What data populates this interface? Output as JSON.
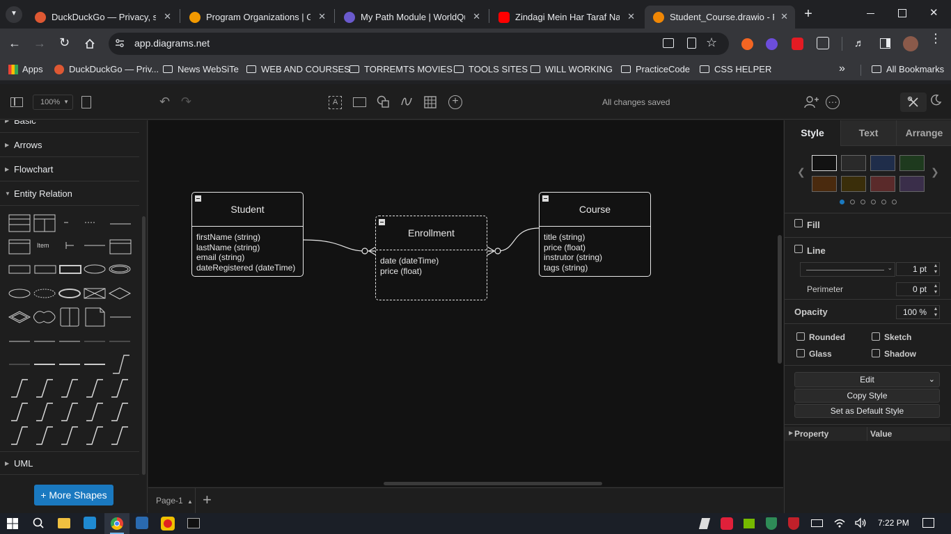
{
  "browser": {
    "tabs": [
      {
        "title": "DuckDuckGo — Privacy, simp",
        "color": "#de5833"
      },
      {
        "title": "Program Organizations | Go",
        "color": "#f29900"
      },
      {
        "title": "My Path Module | WorldQua",
        "color": "#6a5acd"
      },
      {
        "title": "Zindagi Mein Har Taraf Na-K",
        "color": "#ff0000"
      },
      {
        "title": "Student_Course.drawio - Pag",
        "color": "#f08705"
      }
    ],
    "url": "app.diagrams.net",
    "bookmarks": [
      {
        "label": "Apps",
        "icon": "apps-grid-icon"
      },
      {
        "label": "DuckDuckGo — Priv...",
        "icon": "duckduckgo-icon"
      },
      {
        "label": "News WebSiTe",
        "icon": "folder-icon"
      },
      {
        "label": "WEB AND COURSES",
        "icon": "folder-icon"
      },
      {
        "label": "TORREMTS  MOVIES",
        "icon": "folder-icon"
      },
      {
        "label": "TOOLS SITES",
        "icon": "folder-icon"
      },
      {
        "label": "WILL WORKING",
        "icon": "folder-icon"
      },
      {
        "label": "PracticeCode",
        "icon": "folder-icon"
      },
      {
        "label": "CSS HELPER",
        "icon": "folder-icon"
      }
    ],
    "all_bookmarks": "All Bookmarks",
    "more_bookmarks": "»"
  },
  "app": {
    "zoom": "100%",
    "save_status": "All changes saved",
    "sidebar": {
      "sections": [
        "Basic",
        "Arrows",
        "Flowchart",
        "Entity Relation",
        "UML"
      ],
      "shape_item_label": "Item",
      "more_shapes": "+ More Shapes"
    },
    "page": {
      "name": "Page-1"
    },
    "format": {
      "tabs": [
        "Style",
        "Text",
        "Arrange"
      ],
      "swatches": [
        "#1e1e1e",
        "#2a2a2a",
        "#1f2d4a",
        "#1e3a1e",
        "#4a2a0e",
        "#3a2e0a",
        "#5a2a2a",
        "#3a2e4a"
      ],
      "fill": "Fill",
      "line": "Line",
      "line_width": "1 pt",
      "perimeter": "Perimeter",
      "perimeter_value": "0 pt",
      "opacity": "Opacity",
      "opacity_value": "100 %",
      "rounded": "Rounded",
      "sketch": "Sketch",
      "glass": "Glass",
      "shadow": "Shadow",
      "edit": "Edit",
      "copy_style": "Copy Style",
      "set_default": "Set as Default Style",
      "property": "Property",
      "value": "Value"
    }
  },
  "diagram": {
    "student": {
      "title": "Student",
      "attrs": [
        "firstName (string)",
        "lastName (string)",
        "email (string)",
        "dateRegistered (dateTime)"
      ]
    },
    "enrollment": {
      "title": "Enrollment",
      "attrs": [
        "date (dateTime)",
        "price (float)"
      ]
    },
    "course": {
      "title": "Course",
      "attrs": [
        "title (string)",
        "price (float)",
        "instrutor (string)",
        "tags (string)"
      ]
    }
  },
  "taskbar": {
    "time": "7:22 PM"
  }
}
